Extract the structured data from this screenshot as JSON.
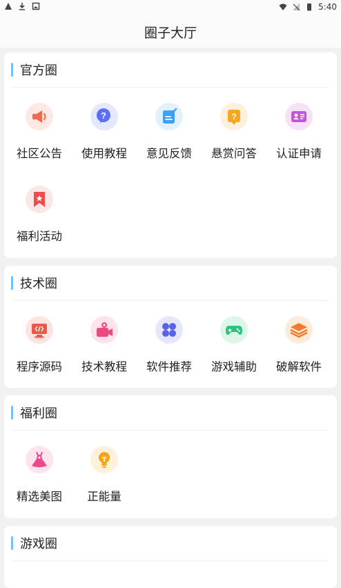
{
  "status": {
    "time": "5:40"
  },
  "header": {
    "title": "圈子大厅"
  },
  "sections": [
    {
      "title": "官方圈",
      "items": [
        {
          "label": "社区公告"
        },
        {
          "label": "使用教程"
        },
        {
          "label": "意见反馈"
        },
        {
          "label": "悬赏问答"
        },
        {
          "label": "认证申请"
        },
        {
          "label": "福利活动"
        }
      ]
    },
    {
      "title": "技术圈",
      "items": [
        {
          "label": "程序源码"
        },
        {
          "label": "技术教程"
        },
        {
          "label": "软件推荐"
        },
        {
          "label": "游戏辅助"
        },
        {
          "label": "破解软件"
        }
      ]
    },
    {
      "title": "福利圈",
      "items": [
        {
          "label": "精选美图"
        },
        {
          "label": "正能量"
        }
      ]
    },
    {
      "title": "游戏圈",
      "items": []
    }
  ],
  "icons": [
    "megaphone-icon",
    "question-bubble-icon",
    "edit-note-icon",
    "question-note-icon",
    "id-card-icon",
    "bookmark-star-icon",
    "code-monitor-icon",
    "video-camera-icon",
    "apps-grid-icon",
    "gamepad-icon",
    "layers-icon",
    "dress-icon",
    "lightbulb-icon"
  ],
  "colors": {
    "accent_bar": "#6ec1ff",
    "background": "#f1f1f1"
  }
}
